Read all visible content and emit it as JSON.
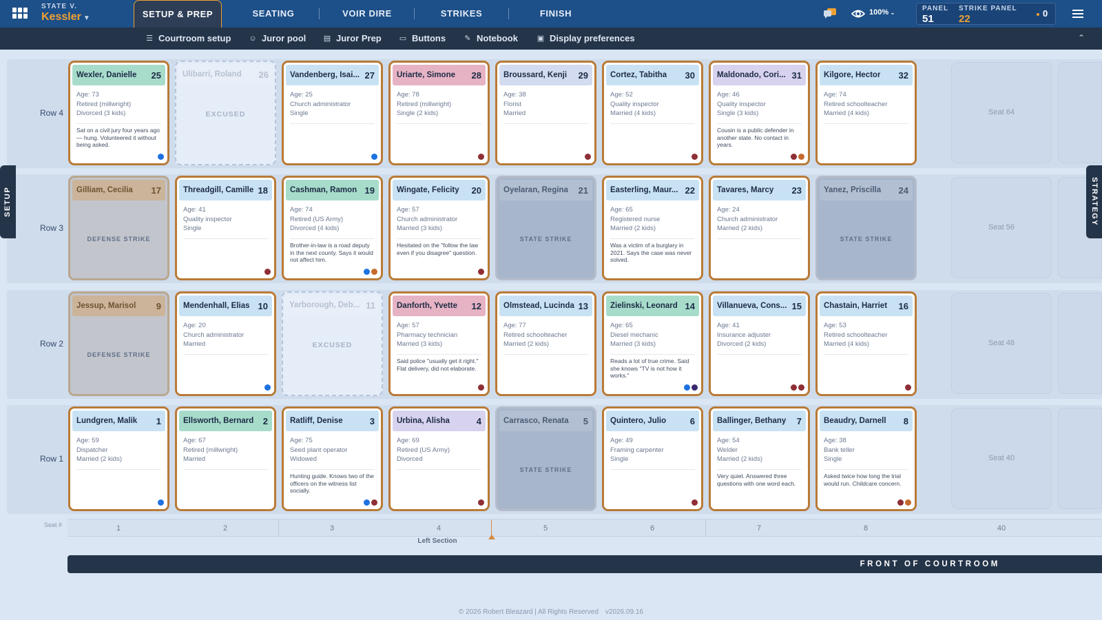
{
  "app": {
    "case_prefix": "STATE V.",
    "case_name": "Kessler",
    "tabs": [
      "SETUP & PREP",
      "SEATING",
      "VOIR DIRE",
      "STRIKES",
      "FINISH"
    ],
    "active_tab": "SETUP & PREP",
    "zoom": "100%",
    "panel_label": "PANEL",
    "panel_value": "51",
    "strike_panel_label": "STRIKE PANEL",
    "strike_panel_value": "22",
    "alerts": "0",
    "accent": "#f0a133"
  },
  "subnav": [
    "Courtroom setup",
    "Juror pool",
    "Juror Prep",
    "Buttons",
    "Notebook",
    "Display preferences"
  ],
  "rows": [
    {
      "label": "Row 4",
      "jurors": [
        {
          "name": "Wexler, Danielle",
          "seat": "25",
          "header": "#a7dccb",
          "lines": [
            "Age: 73",
            "Retired (millwright)",
            "Divorced (3 kids)"
          ],
          "note": "Sat on a civil jury four years ago — hung. Volunteered it without being asked.",
          "dots": [
            "#1e72e0"
          ]
        },
        {
          "name": "Ulibarri, Roland",
          "seat": "26",
          "status": "EXCUSED",
          "kind": "excused"
        },
        {
          "name": "Vandenberg, Isai...",
          "seat": "27",
          "header": "#c8e2f4",
          "lines": [
            "Age: 25",
            "Church administrator",
            "Single"
          ],
          "note": "",
          "dots": [
            "#1e72e0"
          ]
        },
        {
          "name": "Uriarte, Simone",
          "seat": "28",
          "header": "#e6b3c4",
          "lines": [
            "Age: 78",
            "Retired (millwright)",
            "Single (2 kids)"
          ],
          "note": "",
          "dots": [
            "#8e2f35"
          ]
        },
        {
          "name": "Broussard, Kenji",
          "seat": "29",
          "header": "#d2dbef",
          "lines": [
            "Age: 38",
            "Florist",
            "Married"
          ],
          "note": "",
          "dots": [
            "#8e2f35"
          ]
        },
        {
          "name": "Cortez, Tabitha",
          "seat": "30",
          "header": "#c8e2f4",
          "lines": [
            "Age: 52",
            "Quality inspector",
            "Married (4 kids)"
          ],
          "note": "",
          "dots": [
            "#8e2f35"
          ]
        },
        {
          "name": "Maldonado, Cori...",
          "seat": "31",
          "header": "#d7d2ee",
          "lines": [
            "Age: 46",
            "Quality inspector",
            "Single (3 kids)"
          ],
          "note": "Cousin is a public defender in another state. No contact in years.",
          "dots": [
            "#8e2f35",
            "#c56a2d"
          ]
        },
        {
          "name": "Kilgore, Hector",
          "seat": "32",
          "header": "#c8e2f4",
          "lines": [
            "Age: 74",
            "Retired schoolteacher",
            "Married (4 kids)"
          ],
          "note": "",
          "dots": []
        }
      ],
      "seat_label": "Seat 64"
    },
    {
      "label": "Row 3",
      "jurors": [
        {
          "name": "Gilliam, Cecilia",
          "seat": "17",
          "status": "DEFENSE STRIKE",
          "kind": "defense"
        },
        {
          "name": "Threadgill, Camille",
          "seat": "18",
          "header": "#c8e2f4",
          "lines": [
            "Age: 41",
            "Quality inspector",
            "Single"
          ],
          "note": "",
          "dots": [
            "#8e2f35"
          ]
        },
        {
          "name": "Cashman, Ramon",
          "seat": "19",
          "header": "#a7dccb",
          "lines": [
            "Age: 74",
            "Retired (US Army)",
            "Divorced (4 kids)"
          ],
          "note": "Brother-in-law is a road deputy in the next county. Says it would not affect him.",
          "dots": [
            "#1e72e0",
            "#c56a2d"
          ]
        },
        {
          "name": "Wingate, Felicity",
          "seat": "20",
          "header": "#c8e2f4",
          "lines": [
            "Age: 57",
            "Church administrator",
            "Married (3 kids)"
          ],
          "note": "Hesitated on the \"follow the law even if you disagree\" question.",
          "dots": [
            "#8e2f35"
          ]
        },
        {
          "name": "Oyelaran, Regina",
          "seat": "21",
          "status": "STATE STRIKE",
          "kind": "state"
        },
        {
          "name": "Easterling, Maur...",
          "seat": "22",
          "header": "#c8e2f4",
          "lines": [
            "Age: 65",
            "Registered nurse",
            "Married (2 kids)"
          ],
          "note": "Was a victim of a burglary in 2021. Says the case was never solved.",
          "dots": []
        },
        {
          "name": "Tavares, Marcy",
          "seat": "23",
          "header": "#c8e2f4",
          "lines": [
            "Age: 24",
            "Church administrator",
            "Married (2 kids)"
          ],
          "note": "",
          "dots": []
        },
        {
          "name": "Yanez, Priscilla",
          "seat": "24",
          "status": "STATE STRIKE",
          "kind": "state"
        }
      ],
      "seat_label": "Seat 56"
    },
    {
      "label": "Row 2",
      "jurors": [
        {
          "name": "Jessup, Marisol",
          "seat": "9",
          "status": "DEFENSE STRIKE",
          "kind": "defense"
        },
        {
          "name": "Mendenhall, Elias",
          "seat": "10",
          "header": "#c8e2f4",
          "lines": [
            "Age: 20",
            "Church administrator",
            "Married"
          ],
          "note": "",
          "dots": [
            "#1e72e0"
          ]
        },
        {
          "name": "Yarborough, Deb...",
          "seat": "11",
          "status": "EXCUSED",
          "kind": "excused"
        },
        {
          "name": "Danforth, Yvette",
          "seat": "12",
          "header": "#e6b3c4",
          "lines": [
            "Age: 57",
            "Pharmacy technician",
            "Married (3 kids)"
          ],
          "note": "Said police \"usually get it right.\" Flat delivery, did not elaborate.",
          "dots": [
            "#8e2f35"
          ]
        },
        {
          "name": "Olmstead, Lucinda",
          "seat": "13",
          "header": "#c8e2f4",
          "lines": [
            "Age: 77",
            "Retired schoolteacher",
            "Married (2 kids)"
          ],
          "note": "",
          "dots": []
        },
        {
          "name": "Zielinski, Leonard",
          "seat": "14",
          "header": "#a7dccb",
          "lines": [
            "Age: 65",
            "Diesel mechanic",
            "Married (3 kids)"
          ],
          "note": "Reads a lot of true crime. Said she knows \"TV is not how it works.\"",
          "dots": [
            "#1e72e0",
            "#3b2a6e"
          ]
        },
        {
          "name": "Villanueva, Cons...",
          "seat": "15",
          "header": "#c8e2f4",
          "lines": [
            "Age: 41",
            "Insurance adjuster",
            "Divorced (2 kids)"
          ],
          "note": "",
          "dots": [
            "#8e2f35",
            "#8e2f35"
          ]
        },
        {
          "name": "Chastain, Harriet",
          "seat": "16",
          "header": "#c8e2f4",
          "lines": [
            "Age: 53",
            "Retired schoolteacher",
            "Married (4 kids)"
          ],
          "note": "",
          "dots": [
            "#8e2f35"
          ]
        }
      ],
      "seat_label": "Seat 48"
    },
    {
      "label": "Row 1",
      "jurors": [
        {
          "name": "Lundgren, Malik",
          "seat": "1",
          "header": "#c8e2f4",
          "lines": [
            "Age: 59",
            "Dispatcher",
            "Married (2 kids)"
          ],
          "note": "",
          "dots": [
            "#1e72e0"
          ]
        },
        {
          "name": "Ellsworth, Bernard",
          "seat": "2",
          "header": "#a7dccb",
          "lines": [
            "Age: 67",
            "Retired (millwright)",
            "Married"
          ],
          "note": "",
          "dots": []
        },
        {
          "name": "Ratliff, Denise",
          "seat": "3",
          "header": "#c8e2f4",
          "lines": [
            "Age: 75",
            "Seed plant operator",
            "Widowed"
          ],
          "note": "Hunting guide. Knows two of the officers on the witness list socially.",
          "dots": [
            "#1e72e0",
            "#8e2f35"
          ]
        },
        {
          "name": "Urbina, Alisha",
          "seat": "4",
          "header": "#d7d2ee",
          "lines": [
            "Age: 69",
            "Retired (US Army)",
            "Divorced"
          ],
          "note": "",
          "dots": [
            "#8e2f35"
          ]
        },
        {
          "name": "Carrasco, Renata",
          "seat": "5",
          "status": "STATE STRIKE",
          "kind": "state"
        },
        {
          "name": "Quintero, Julio",
          "seat": "6",
          "header": "#c8e2f4",
          "lines": [
            "Age: 49",
            "Framing carpenter",
            "Single"
          ],
          "note": "",
          "dots": [
            "#8e2f35"
          ]
        },
        {
          "name": "Ballinger, Bethany",
          "seat": "7",
          "header": "#c8e2f4",
          "lines": [
            "Age: 54",
            "Welder",
            "Married (2 kids)"
          ],
          "note": "Very quiet. Answered three questions with one word each.",
          "dots": []
        },
        {
          "name": "Beaudry, Darnell",
          "seat": "8",
          "header": "#c8e2f4",
          "lines": [
            "Age: 38",
            "Bank teller",
            "Single"
          ],
          "note": "Asked twice how long the trial would run. Childcare concern.",
          "dots": [
            "#8e2f35",
            "#c56a2d"
          ]
        }
      ],
      "seat_label": "Seat 40"
    }
  ],
  "seat_strip": {
    "label": "Seat #",
    "numbers": [
      "1",
      "2",
      "3",
      "4",
      "5",
      "6",
      "7",
      "8",
      "40"
    ],
    "section": "Left Section"
  },
  "front_label": "FRONT OF COURTROOM",
  "footer": {
    "copyright": "© 2026 Robert Bleazard | All Rights Reserved",
    "version": "v2026.09.16"
  },
  "side_tabs": {
    "left": "SETUP",
    "right": "STRATEGY"
  }
}
